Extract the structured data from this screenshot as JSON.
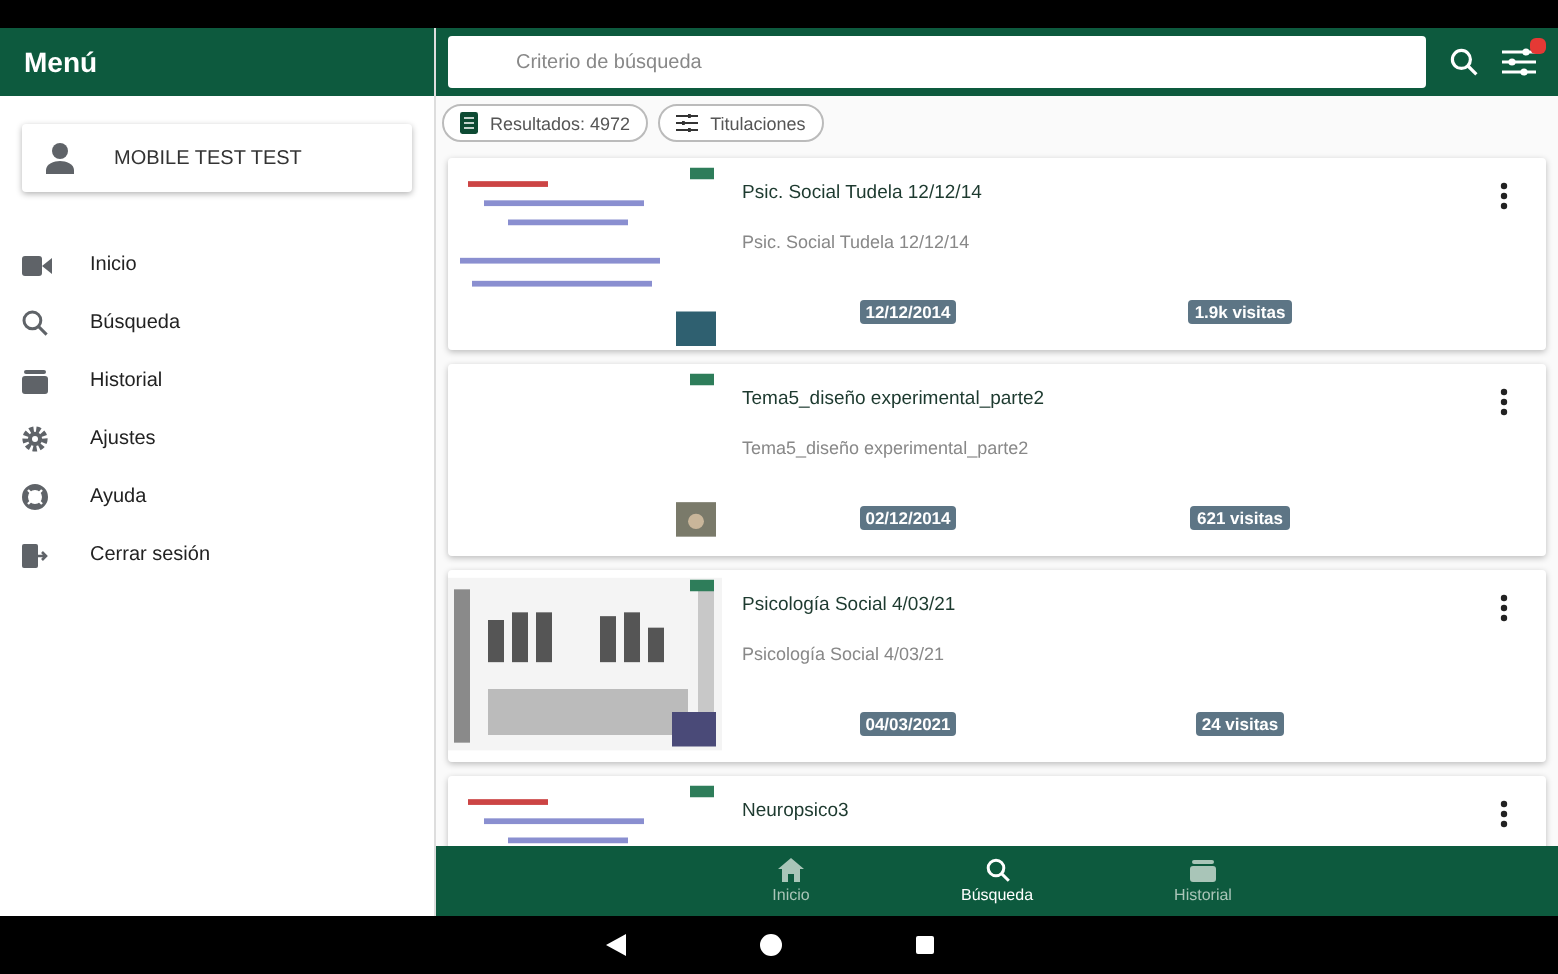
{
  "sidebar": {
    "title": "Menú",
    "user": "MOBILE TEST TEST",
    "items": [
      {
        "label": "Inicio"
      },
      {
        "label": "Búsqueda"
      },
      {
        "label": "Historial"
      },
      {
        "label": "Ajustes"
      },
      {
        "label": "Ayuda"
      },
      {
        "label": "Cerrar sesión"
      }
    ]
  },
  "search": {
    "placeholder": "Criterio de búsqueda"
  },
  "chips": [
    {
      "label": "Resultados: 4972"
    },
    {
      "label": "Titulaciones"
    }
  ],
  "results": [
    {
      "title": "Psic. Social Tudela 12/12/14",
      "subtitle": "Psic. Social Tudela 12/12/14",
      "date": "12/12/2014",
      "views": "1.9k visitas"
    },
    {
      "title": "Tema5_diseño experimental_parte2",
      "subtitle": "Tema5_diseño experimental_parte2",
      "date": "02/12/2014",
      "views": "621 visitas"
    },
    {
      "title": "Psicología Social 4/03/21",
      "subtitle": "Psicología Social 4/03/21",
      "date": "04/03/2021",
      "views": "24 visitas"
    },
    {
      "title": "Neuropsico3"
    }
  ],
  "bottom_nav": [
    {
      "label": "Inicio",
      "selected": false
    },
    {
      "label": "Búsqueda",
      "selected": true
    },
    {
      "label": "Historial",
      "selected": false
    }
  ]
}
